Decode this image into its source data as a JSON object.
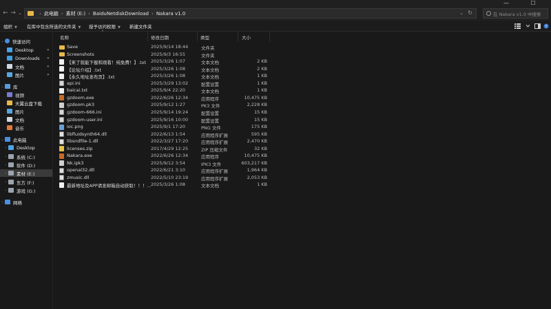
{
  "nav": {
    "back": "←",
    "forward": "→",
    "dropdown": "⌄",
    "up": "↑"
  },
  "address": {
    "crumbs": [
      "此电脑",
      "素材 (E:)",
      "BaiduNetdiskDownload",
      "Nakara v1.0"
    ],
    "separator": "›",
    "chevron": "⌄",
    "refresh": "↻"
  },
  "search": {
    "placeholder": "在 Nakara v1.0 中搜索"
  },
  "window": {
    "minimize": "—",
    "maximize": "☐",
    "close": "✕"
  },
  "toolbar": {
    "organize": "组织",
    "include_in_library": "在库中包含所选的文件夹",
    "share_with": "授予访问权限",
    "new_folder": "新建文件夹",
    "arrow": "▼"
  },
  "sidebar": {
    "quick_access": "快速访问",
    "quick_items": [
      {
        "label": "Desktop",
        "icon": "desktop-folder-icon",
        "pinned": true
      },
      {
        "label": "Downloads",
        "icon": "downloads-icon",
        "pinned": true
      },
      {
        "label": "文档",
        "icon": "documents-icon",
        "pinned": true
      },
      {
        "label": "图片",
        "icon": "pictures-icon",
        "pinned": true
      }
    ],
    "pin_glyph": "📌",
    "library": "库",
    "library_items": [
      {
        "label": "视频",
        "icon": "videos-icon"
      },
      {
        "label": "天翼云盘下载",
        "icon": "cloud-folder-icon"
      },
      {
        "label": "图片",
        "icon": "pictures-icon"
      },
      {
        "label": "文档",
        "icon": "documents-icon"
      },
      {
        "label": "音乐",
        "icon": "music-icon"
      }
    ],
    "this_pc": "此电脑",
    "pc_items": [
      {
        "label": "Desktop",
        "icon": "desktop-icon"
      },
      {
        "label": "系统 (C:)",
        "icon": "drive-icon"
      },
      {
        "label": "软件 (D:)",
        "icon": "drive-icon"
      },
      {
        "label": "素材 (E:)",
        "icon": "drive-icon",
        "selected": true
      },
      {
        "label": "东方 (F:)",
        "icon": "drive-icon"
      },
      {
        "label": "游戏 (G:)",
        "icon": "drive-icon"
      }
    ],
    "network": "网络"
  },
  "columns": {
    "name": "名称",
    "date": "修改日期",
    "type": "类型",
    "size": "大小",
    "sort_arrow": "^"
  },
  "files": [
    {
      "name": "Save",
      "date": "2025/9/14 18:44",
      "type": "文件夹",
      "size": "",
      "kind": "folder"
    },
    {
      "name": "Screenshots",
      "date": "2025/9/3 16:55",
      "type": "文件夹",
      "size": "",
      "kind": "folder"
    },
    {
      "name": "【来了就能下載和观看！纯免費！】.txt",
      "date": "2025/3/26 1:07",
      "type": "文本文档",
      "size": "2 KB",
      "kind": "txt"
    },
    {
      "name": "【论坛介绍】.txt",
      "date": "2025/3/26 1:08",
      "type": "文本文档",
      "size": "2 KB",
      "kind": "txt"
    },
    {
      "name": "【永久地址发布页】.txt",
      "date": "2025/3/26 1:08",
      "type": "文本文档",
      "size": "1 KB",
      "kind": "txt"
    },
    {
      "name": "api.ini",
      "date": "2025/3/29 13:02",
      "type": "配置设置",
      "size": "1 KB",
      "kind": "ini"
    },
    {
      "name": "baicai.txt",
      "date": "2025/9/4 22:20",
      "type": "文本文档",
      "size": "1 KB",
      "kind": "txt"
    },
    {
      "name": "gzdoom.exe",
      "date": "2022/6/26 12:34",
      "type": "应用程序",
      "size": "10,475 KB",
      "kind": "exe"
    },
    {
      "name": "gzdoom.pk3",
      "date": "2025/9/12 1:27",
      "type": "PK3 文件",
      "size": "2,228 KB",
      "kind": "pk3"
    },
    {
      "name": "gzdoom-666.ini",
      "date": "2025/9/14 19:24",
      "type": "配置设置",
      "size": "15 KB",
      "kind": "ini"
    },
    {
      "name": "gzdoom-user.ini",
      "date": "2025/9/16 10:00",
      "type": "配置设置",
      "size": "15 KB",
      "kind": "ini"
    },
    {
      "name": "ioc.png",
      "date": "2025/9/1 17:20",
      "type": "PNG 文件",
      "size": "175 KB",
      "kind": "png"
    },
    {
      "name": "libfluidsynth64.dll",
      "date": "2022/6/13 1:54",
      "type": "应用程序扩展",
      "size": "595 KB",
      "kind": "dll"
    },
    {
      "name": "libsndfile-1.dll",
      "date": "2022/3/27 17:20",
      "type": "应用程序扩展",
      "size": "2,470 KB",
      "kind": "dll"
    },
    {
      "name": "licenses.zip",
      "date": "2017/4/29 12:25",
      "type": "ZIP 压缩文件",
      "size": "32 KB",
      "kind": "zip"
    },
    {
      "name": "Nakara.exe",
      "date": "2022/6/26 12:34",
      "type": "应用程序",
      "size": "10,475 KB",
      "kind": "exe"
    },
    {
      "name": "Nk.ipk3",
      "date": "2025/9/12 3:54",
      "type": "IPK3 文件",
      "size": "603,217 KB",
      "kind": "pk3"
    },
    {
      "name": "openal32.dll",
      "date": "2022/6/21 3:10",
      "type": "应用程序扩展",
      "size": "1,964 KB",
      "kind": "dll"
    },
    {
      "name": "zmusic.dll",
      "date": "2022/5/10 23:19",
      "type": "应用程序扩展",
      "size": "2,053 KB",
      "kind": "dll"
    },
    {
      "name": "最新地址及APP请发邮箱自动获取！！！...",
      "date": "2025/3/26 1:08",
      "type": "文本文档",
      "size": "1 KB",
      "kind": "txt"
    }
  ],
  "colors": {
    "folder": "#e8b84a",
    "selected_bg": "#3a3a3a",
    "background": "#191919"
  }
}
